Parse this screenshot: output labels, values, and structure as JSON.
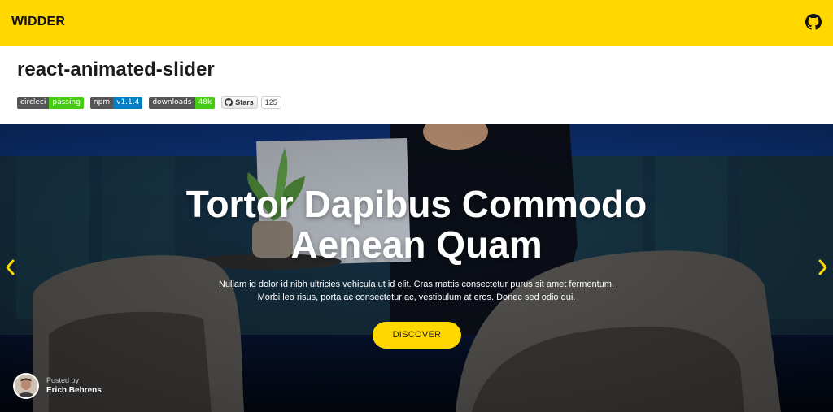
{
  "header": {
    "brand": "WIDDER",
    "github_icon": "github-icon",
    "bg_color": "#ffd800"
  },
  "repo": {
    "title": "react-animated-slider",
    "badges": [
      {
        "label": "circleci",
        "value": "passing",
        "color": "#4c1"
      },
      {
        "label": "npm",
        "value": "v1.1.4",
        "color": "#007ec6"
      },
      {
        "label": "downloads",
        "value": "48k",
        "color": "#4c1"
      }
    ],
    "github_star": {
      "label": "Stars",
      "count": "125"
    }
  },
  "slide": {
    "title_line1": "Tortor Dapibus Commodo",
    "title_line2": "Aenean Quam",
    "text_line1": "Nullam id dolor id nibh ultricies vehicula ut id elit. Cras mattis consectetur purus sit amet fermentum.",
    "text_line2": "Morbi leo risus, porta ac consectetur ac, vestibulum at eros. Donec sed odio dui.",
    "button": "DISCOVER",
    "accent": "#ffd800"
  },
  "author": {
    "posted_by": "Posted by",
    "name": "Erich Behrens"
  },
  "nav": {
    "prev_icon": "chevron-left-icon",
    "next_icon": "chevron-right-icon"
  }
}
